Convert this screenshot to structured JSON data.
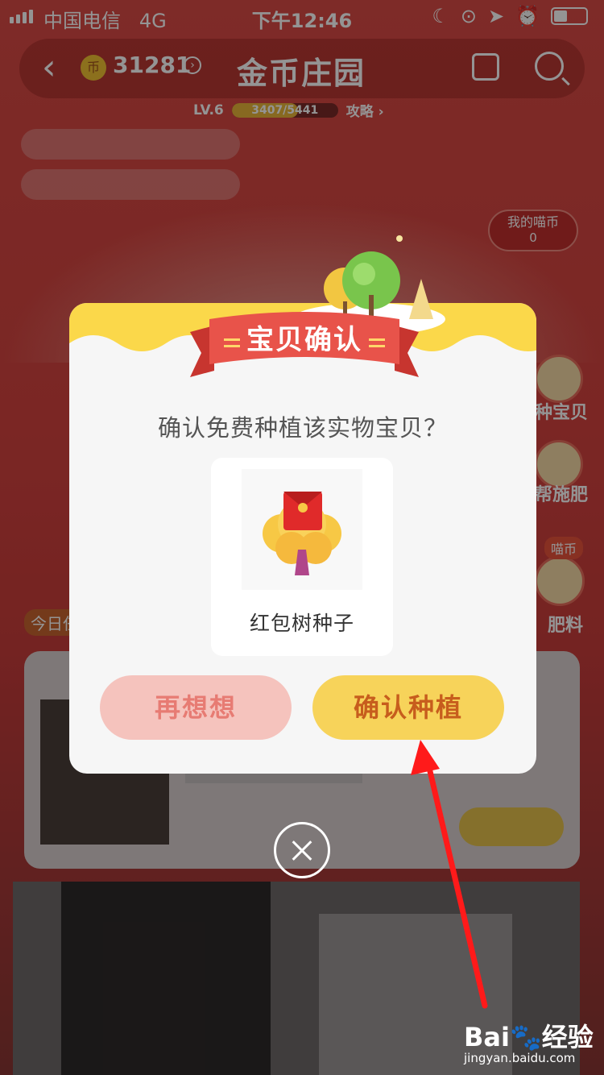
{
  "status_bar": {
    "carrier": "中国电信",
    "network": "4G",
    "time": "下午12:46"
  },
  "navbar": {
    "coin_label": "币",
    "coin_count": "31281",
    "title": "金币庄园",
    "level": "LV.6",
    "level_progress": "3407/5441",
    "level_fraction": 0.626,
    "guide_link": "攻略 ›"
  },
  "side": {
    "my_coins_label": "我的喵币",
    "my_coins_value": "0",
    "plant_label": "种宝贝",
    "help_fertilize_label": "帮施肥",
    "fertilizer_badge": "喵币",
    "fertilizer_label": "肥料",
    "today_label": "今日任"
  },
  "dialog": {
    "title": "宝贝确认",
    "question": "确认免费种植该实物宝贝？",
    "product_name": "红包树种子",
    "cancel_label": "再想想",
    "confirm_label": "确认种植"
  },
  "watermark": {
    "logo": "Bai🐾经验",
    "url": "jingyan.baidu.com"
  },
  "colors": {
    "accent_yellow": "#f7d35a",
    "cancel_pink": "#f5c3bd",
    "ribbon_red": "#e8534a",
    "annotation_arrow": "#ff1a1a"
  },
  "icons": [
    "back-icon",
    "coin-icon",
    "calendar-icon",
    "search-icon",
    "close-icon",
    "tree-icon",
    "red-envelope-tree-icon"
  ]
}
